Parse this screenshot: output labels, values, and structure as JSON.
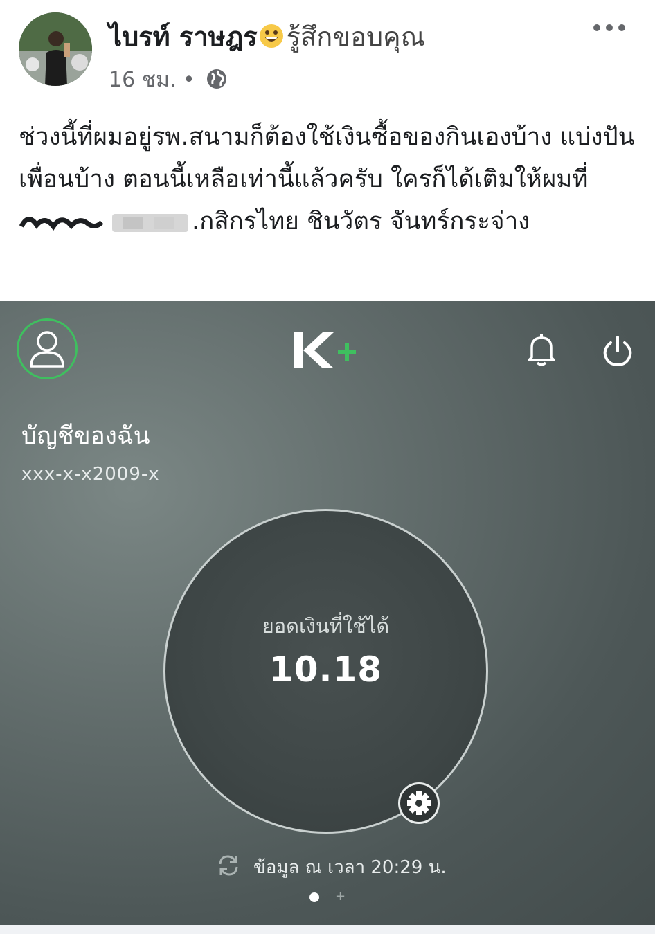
{
  "post": {
    "author_name": "ไบรท์ ราษฎร",
    "feeling": "รู้สึกขอบคุณ",
    "timestamp": "16 ชม.",
    "separator": "•",
    "text_before_redaction": "ช่วงนี้ที่ผมอยู่รพ.สนามก็ต้องใช้เงินซื้อของกินเองบ้าง แบ่งปันเพื่อนบ้าง ตอนนี้เหลือเท่านี้แล้วครับ ใครก็ได้เติมให้ผมที่",
    "text_after_redaction": ".กสิกรไทย ชินวัตร จันทร์กระจ่าง",
    "icons": {
      "emoji": "grinning-face-icon",
      "privacy": "globe-icon",
      "more": "more-options-icon"
    }
  },
  "kplus": {
    "logo_text": "K",
    "account_title": "บัญชีของฉัน",
    "account_number": "xxx-x-x2009-x",
    "balance_label": "ยอดเงินที่ใช้ได้",
    "balance_value": "10.18",
    "updated_text": "ข้อมูล ณ เวลา 20:29 น.",
    "page_plus": "+",
    "colors": {
      "accent_green": "#3fbf5f",
      "background": "#5c6666"
    }
  }
}
